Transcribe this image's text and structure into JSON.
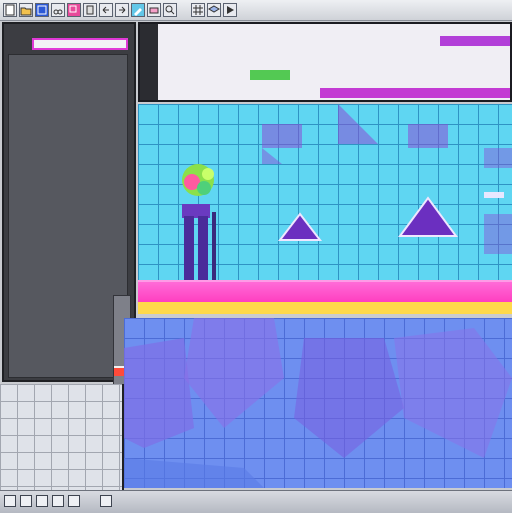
{
  "toolbar": {
    "icons": [
      "new-file-icon",
      "open-folder-icon",
      "save-icon",
      "cut-icon",
      "copy-icon",
      "paste-icon",
      "undo-icon",
      "redo-icon",
      "brush-icon",
      "eraser-icon",
      "zoom-icon",
      "grid-icon",
      "layer-icon",
      "play-icon"
    ]
  },
  "left_panel": {
    "header": "",
    "rows": [
      {
        "key": "",
        "val": ""
      },
      {
        "key": "",
        "val": ""
      },
      {
        "key": "",
        "val": ""
      },
      {
        "key": "",
        "val": ""
      },
      {
        "key": "",
        "val": ""
      },
      {
        "key": "",
        "val": ""
      },
      {
        "key": "",
        "val": ""
      },
      {
        "key": "",
        "val": ""
      },
      {
        "key": "",
        "val": ""
      },
      {
        "key": "",
        "val": ""
      },
      {
        "key": "",
        "val": ""
      },
      {
        "key": "",
        "val": ""
      },
      {
        "key": "",
        "val": ""
      },
      {
        "key": "",
        "val": ""
      },
      {
        "key": "",
        "val": ""
      },
      {
        "key": "",
        "val": ""
      },
      {
        "key": "",
        "val": ""
      },
      {
        "key": "",
        "val": ""
      },
      {
        "key": "",
        "val": ""
      },
      {
        "key": "",
        "val": ""
      }
    ]
  },
  "text_panel": {
    "lines": [
      "",
      "",
      "",
      "",
      ""
    ]
  },
  "colors": {
    "sky": "#5fd6f2",
    "floor": "#ff3fc0",
    "accent": "#e03ad6",
    "character_body": "#4a2c9a",
    "character_head": "#8be04a",
    "shape_fill": "#8a4fd6",
    "lower_bg": "#6e8ff0"
  },
  "statusbar": {
    "icons": [
      "start-icon",
      "task-icon-1",
      "task-icon-2",
      "task-icon-3",
      "task-icon-4",
      "task-icon-5"
    ]
  }
}
